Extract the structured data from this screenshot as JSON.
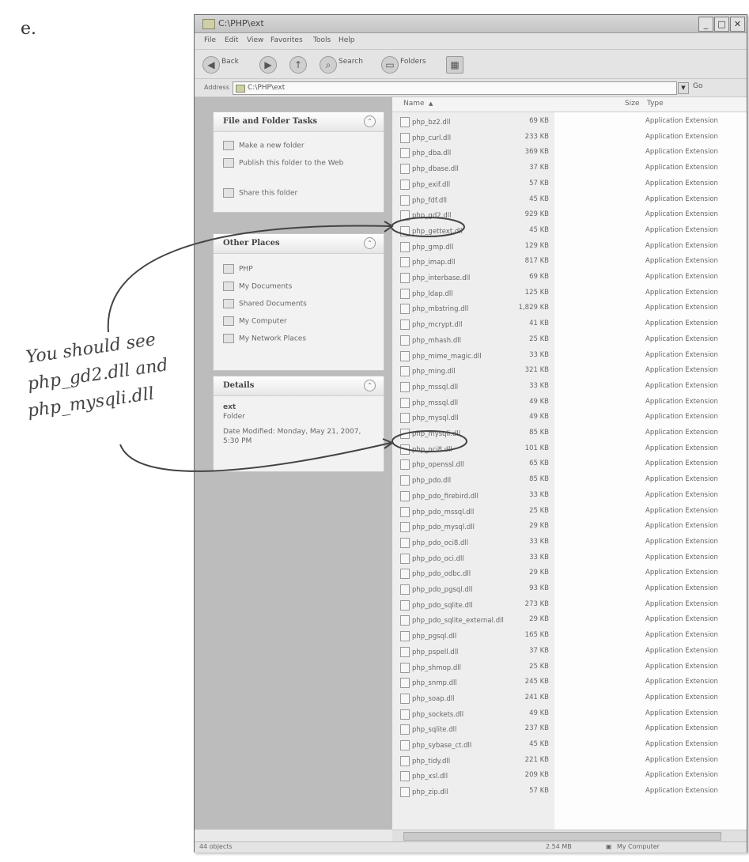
{
  "stray_text": "e.",
  "window": {
    "title": "C:\\PHP\\ext",
    "minimize": "_",
    "maximize": "□",
    "close": "✕"
  },
  "menu": [
    "File",
    "Edit",
    "View",
    "Favorites",
    "Tools",
    "Help"
  ],
  "toolbar": {
    "back": "Back",
    "search": "Search",
    "folders": "Folders"
  },
  "address": {
    "label": "Address",
    "value": "C:\\PHP\\ext",
    "go": "Go"
  },
  "panels": {
    "file_folder_tasks": {
      "title": "File and Folder Tasks",
      "items": [
        "Make a new folder",
        "Publish this folder to the Web",
        "Share this folder"
      ]
    },
    "other_places": {
      "title": "Other Places",
      "items": [
        "PHP",
        "My Documents",
        "Shared Documents",
        "My Computer",
        "My Network Places"
      ]
    },
    "details": {
      "title": "Details",
      "name": "ext",
      "kind": "Folder",
      "modified": "Date Modified: Monday, May 21, 2007, 5:30 PM"
    }
  },
  "columns": {
    "name": "Name",
    "size": "Size",
    "type": "Type"
  },
  "files": [
    {
      "name": "php_bz2.dll",
      "size": "69 KB",
      "type": "Application Extension"
    },
    {
      "name": "php_curl.dll",
      "size": "233 KB",
      "type": "Application Extension"
    },
    {
      "name": "php_dba.dll",
      "size": "369 KB",
      "type": "Application Extension"
    },
    {
      "name": "php_dbase.dll",
      "size": "37 KB",
      "type": "Application Extension"
    },
    {
      "name": "php_exif.dll",
      "size": "57 KB",
      "type": "Application Extension"
    },
    {
      "name": "php_fdf.dll",
      "size": "45 KB",
      "type": "Application Extension"
    },
    {
      "name": "php_gd2.dll",
      "size": "929 KB",
      "type": "Application Extension"
    },
    {
      "name": "php_gettext.dll",
      "size": "45 KB",
      "type": "Application Extension"
    },
    {
      "name": "php_gmp.dll",
      "size": "129 KB",
      "type": "Application Extension"
    },
    {
      "name": "php_imap.dll",
      "size": "817 KB",
      "type": "Application Extension"
    },
    {
      "name": "php_interbase.dll",
      "size": "69 KB",
      "type": "Application Extension"
    },
    {
      "name": "php_ldap.dll",
      "size": "125 KB",
      "type": "Application Extension"
    },
    {
      "name": "php_mbstring.dll",
      "size": "1,829 KB",
      "type": "Application Extension"
    },
    {
      "name": "php_mcrypt.dll",
      "size": "41 KB",
      "type": "Application Extension"
    },
    {
      "name": "php_mhash.dll",
      "size": "25 KB",
      "type": "Application Extension"
    },
    {
      "name": "php_mime_magic.dll",
      "size": "33 KB",
      "type": "Application Extension"
    },
    {
      "name": "php_ming.dll",
      "size": "321 KB",
      "type": "Application Extension"
    },
    {
      "name": "php_mssql.dll",
      "size": "33 KB",
      "type": "Application Extension"
    },
    {
      "name": "php_mssql.dll",
      "size": "49 KB",
      "type": "Application Extension"
    },
    {
      "name": "php_mysql.dll",
      "size": "49 KB",
      "type": "Application Extension"
    },
    {
      "name": "php_mysqli.dll",
      "size": "85 KB",
      "type": "Application Extension"
    },
    {
      "name": "php_oci8.dll",
      "size": "101 KB",
      "type": "Application Extension"
    },
    {
      "name": "php_openssl.dll",
      "size": "65 KB",
      "type": "Application Extension"
    },
    {
      "name": "php_pdo.dll",
      "size": "85 KB",
      "type": "Application Extension"
    },
    {
      "name": "php_pdo_firebird.dll",
      "size": "33 KB",
      "type": "Application Extension"
    },
    {
      "name": "php_pdo_mssql.dll",
      "size": "25 KB",
      "type": "Application Extension"
    },
    {
      "name": "php_pdo_mysql.dll",
      "size": "29 KB",
      "type": "Application Extension"
    },
    {
      "name": "php_pdo_oci8.dll",
      "size": "33 KB",
      "type": "Application Extension"
    },
    {
      "name": "php_pdo_oci.dll",
      "size": "33 KB",
      "type": "Application Extension"
    },
    {
      "name": "php_pdo_odbc.dll",
      "size": "29 KB",
      "type": "Application Extension"
    },
    {
      "name": "php_pdo_pgsql.dll",
      "size": "93 KB",
      "type": "Application Extension"
    },
    {
      "name": "php_pdo_sqlite.dll",
      "size": "273 KB",
      "type": "Application Extension"
    },
    {
      "name": "php_pdo_sqlite_external.dll",
      "size": "29 KB",
      "type": "Application Extension"
    },
    {
      "name": "php_pgsql.dll",
      "size": "165 KB",
      "type": "Application Extension"
    },
    {
      "name": "php_pspell.dll",
      "size": "37 KB",
      "type": "Application Extension"
    },
    {
      "name": "php_shmop.dll",
      "size": "25 KB",
      "type": "Application Extension"
    },
    {
      "name": "php_snmp.dll",
      "size": "245 KB",
      "type": "Application Extension"
    },
    {
      "name": "php_soap.dll",
      "size": "241 KB",
      "type": "Application Extension"
    },
    {
      "name": "php_sockets.dll",
      "size": "49 KB",
      "type": "Application Extension"
    },
    {
      "name": "php_sqlite.dll",
      "size": "237 KB",
      "type": "Application Extension"
    },
    {
      "name": "php_sybase_ct.dll",
      "size": "45 KB",
      "type": "Application Extension"
    },
    {
      "name": "php_tidy.dll",
      "size": "221 KB",
      "type": "Application Extension"
    },
    {
      "name": "php_xsl.dll",
      "size": "209 KB",
      "type": "Application Extension"
    },
    {
      "name": "php_zip.dll",
      "size": "57 KB",
      "type": "Application Extension"
    }
  ],
  "status": {
    "objects": "44 objects",
    "size": "2.54 MB",
    "location": "My Computer"
  },
  "annotation": {
    "line1": "You should see",
    "line2": "php_gd2.dll and",
    "line3": "php_mysqli.dll"
  }
}
